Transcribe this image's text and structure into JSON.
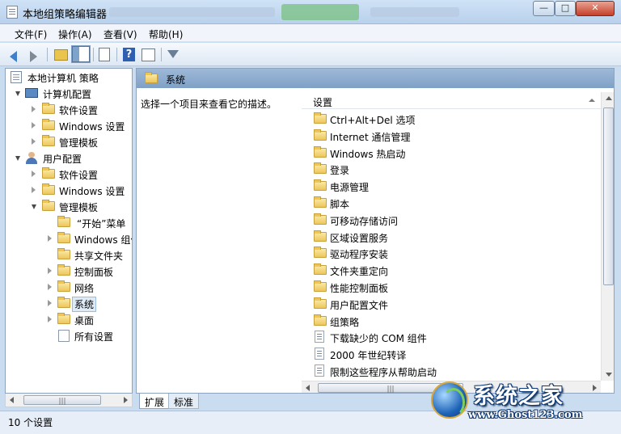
{
  "window": {
    "title": "本地组策略编辑器",
    "controls": {
      "minimize": "—",
      "maximize": "□",
      "close": "✕"
    }
  },
  "menu": [
    {
      "label": "文件(F)"
    },
    {
      "label": "操作(A)"
    },
    {
      "label": "查看(V)"
    },
    {
      "label": "帮助(H)"
    }
  ],
  "toolbar": {
    "icons": [
      "back-arrow-icon",
      "forward-arrow-icon",
      "up-folder-icon",
      "show-hide-tree-icon",
      "export-list-icon",
      "help-icon",
      "properties-icon",
      "filter-icon"
    ],
    "help_glyph": "?"
  },
  "tree": {
    "root": "本地计算机 策略",
    "computer_config": "计算机配置",
    "cc_software": "软件设置",
    "cc_windows": "Windows 设置",
    "cc_admin": "管理模板",
    "user_config": "用户配置",
    "uc_software": "软件设置",
    "uc_windows": "Windows 设置",
    "uc_admin": "管理模板",
    "start_menu": "“开始”菜单",
    "windows_components": "Windows 组件",
    "shared_folders": "共享文件夹",
    "control_panel": "控制面板",
    "network": "网络",
    "system": "系统",
    "desktop": "桌面",
    "all_settings": "所有设置"
  },
  "right_pane": {
    "header_title": "系统",
    "description": "选择一个项目来查看它的描述。",
    "column_header": "设置",
    "items": [
      {
        "label": "Ctrl+Alt+Del 选项",
        "icon": "folder-icon"
      },
      {
        "label": "Internet 通信管理",
        "icon": "folder-icon"
      },
      {
        "label": "Windows 热启动",
        "icon": "folder-icon"
      },
      {
        "label": "登录",
        "icon": "folder-icon"
      },
      {
        "label": "电源管理",
        "icon": "folder-icon"
      },
      {
        "label": "脚本",
        "icon": "folder-icon"
      },
      {
        "label": "可移动存储访问",
        "icon": "folder-icon"
      },
      {
        "label": "区域设置服务",
        "icon": "folder-icon"
      },
      {
        "label": "驱动程序安装",
        "icon": "folder-icon"
      },
      {
        "label": "文件夹重定向",
        "icon": "folder-icon"
      },
      {
        "label": "性能控制面板",
        "icon": "folder-icon"
      },
      {
        "label": "用户配置文件",
        "icon": "folder-icon"
      },
      {
        "label": "组策略",
        "icon": "folder-icon"
      },
      {
        "label": "下载缺少的 COM 组件",
        "icon": "setting-icon"
      },
      {
        "label": "2000 年世纪转译",
        "icon": "setting-icon"
      },
      {
        "label": "限制这些程序从帮助启动",
        "icon": "setting-icon"
      }
    ]
  },
  "tabs": [
    {
      "label": "扩展"
    },
    {
      "label": "标准"
    }
  ],
  "status": {
    "text": "10 个设置"
  },
  "scroll_grip": "|||",
  "watermark": {
    "brand": "系统之家",
    "url": "www.Ghost123.com"
  }
}
